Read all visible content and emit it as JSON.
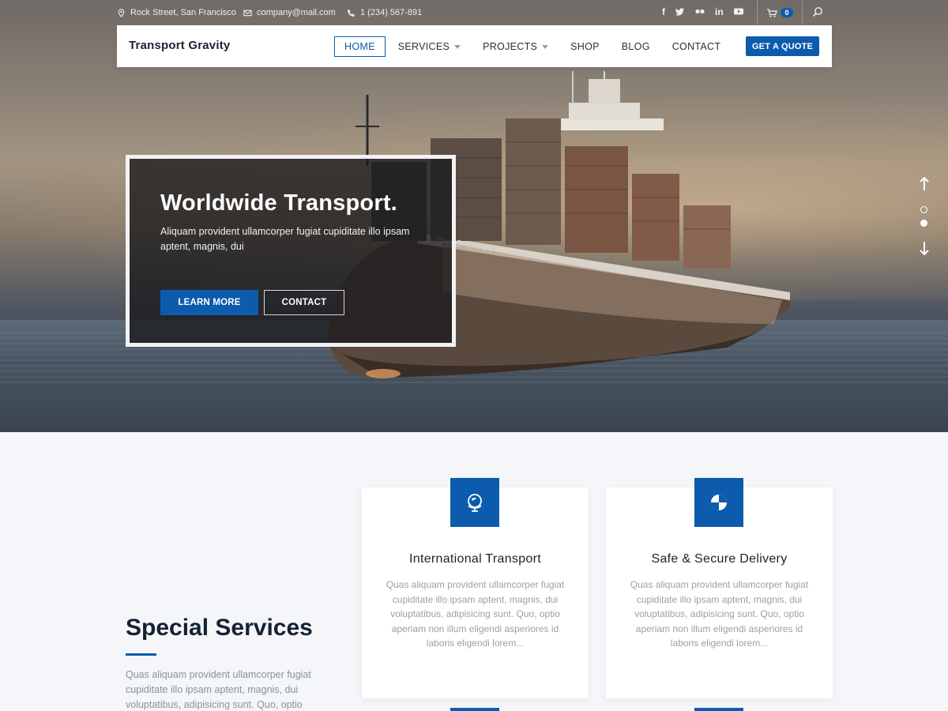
{
  "topbar": {
    "address": "Rock Street, San Francisco",
    "email": "company@mail.com",
    "phone": "1 (234) 567-891",
    "social_icons": [
      "facebook-icon",
      "twitter-icon",
      "flickr-icon",
      "linkedin-icon",
      "youtube-icon"
    ],
    "cart_count": "0"
  },
  "nav": {
    "brand": "Transport Gravity",
    "items": [
      {
        "label": "HOME",
        "active": true,
        "dropdown": false
      },
      {
        "label": "SERVICES",
        "active": false,
        "dropdown": true
      },
      {
        "label": "PROJECTS",
        "active": false,
        "dropdown": true
      },
      {
        "label": "SHOP",
        "active": false,
        "dropdown": false
      },
      {
        "label": "BLOG",
        "active": false,
        "dropdown": false
      },
      {
        "label": "CONTACT",
        "active": false,
        "dropdown": false
      }
    ],
    "cta": "GET A QUOTE"
  },
  "hero": {
    "title": "Worldwide Transport.",
    "text": "Aliquam provident ullamcorper fugiat cupiditate illo ipsam aptent, magnis, dui",
    "primary_button": "LEARN MORE",
    "secondary_button": "CONTACT",
    "ship_name": "CHACABUCO",
    "slides": 2,
    "active_slide": 2
  },
  "special": {
    "heading": "Special Services",
    "text": "Quas aliquam provident ullamcorper fugiat cupiditate illo ipsam aptent, magnis, dui voluptatibus, adipisicing sunt. Quo, optio"
  },
  "cards": [
    {
      "icon": "globe-icon",
      "title": "International Transport",
      "text": "Quas aliquam provident ullamcorper fugiat cupiditate illo ipsam aptent, magnis, dui voluptatibus, adipisicing sunt. Quo, optio aperiam non illum eligendi asperiores id laboris eligendi lorem..."
    },
    {
      "icon": "shield-icon",
      "title": "Safe & Secure Delivery",
      "text": "Quas aliquam provident ullamcorper fugiat cupiditate illo ipsam aptent, magnis, dui voluptatibus, adipisicing sunt. Quo, optio aperiam non illum eligendi asperiores id laboris eligendi lorem..."
    }
  ],
  "colors": {
    "accent": "#0d5bad",
    "heading": "#152233",
    "muted_text": "#9aa0a8",
    "section_bg": "#f4f6f9"
  }
}
